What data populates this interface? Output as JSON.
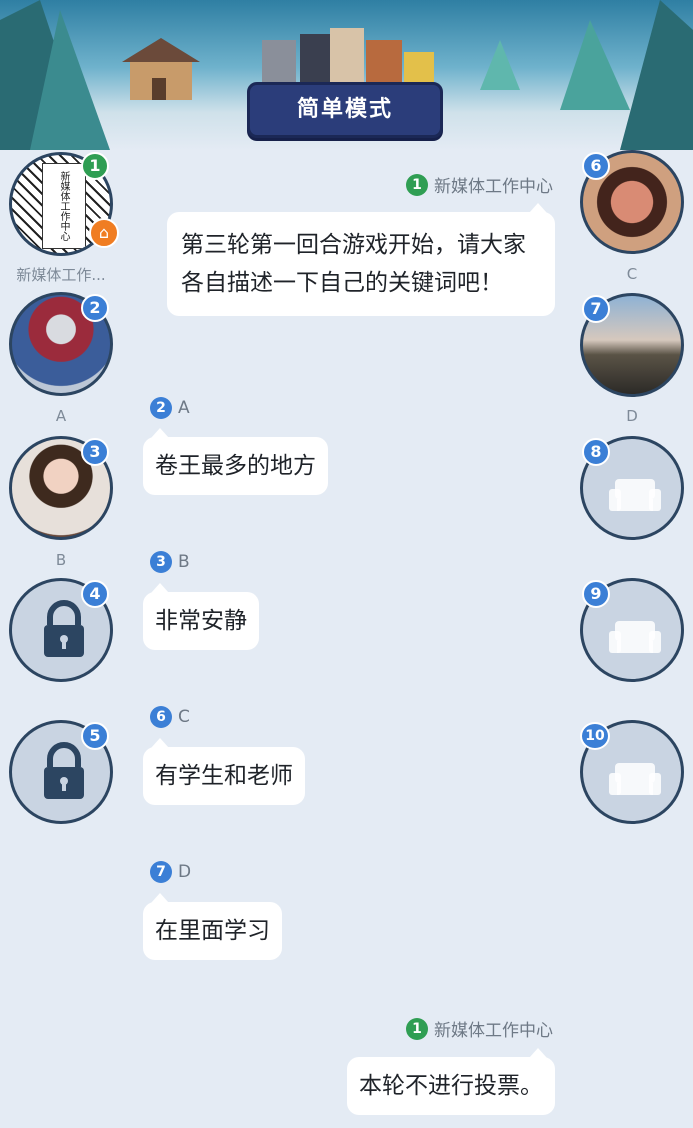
{
  "header": {
    "mode_label": "简单模式"
  },
  "seats": {
    "s1": {
      "number": "1",
      "name": "新媒体工作...",
      "avatar_text": "新媒体工作中心"
    },
    "s2": {
      "number": "2",
      "name": "A"
    },
    "s3": {
      "number": "3",
      "name": "B"
    },
    "s4": {
      "number": "4"
    },
    "s5": {
      "number": "5"
    },
    "s6": {
      "number": "6",
      "name": "C"
    },
    "s7": {
      "number": "7",
      "name": "D"
    },
    "s8": {
      "number": "8"
    },
    "s9": {
      "number": "9"
    },
    "s10": {
      "number": "10"
    }
  },
  "messages": [
    {
      "sender_number": "1",
      "sender": "新媒体工作中心",
      "text": "第三轮第一回合游戏开始，请大家各自描述一下自己的关键词吧！"
    },
    {
      "sender_number": "2",
      "sender": "A",
      "text": "卷王最多的地方"
    },
    {
      "sender_number": "3",
      "sender": "B",
      "text": "非常安静"
    },
    {
      "sender_number": "6",
      "sender": "C",
      "text": "有学生和老师"
    },
    {
      "sender_number": "7",
      "sender": "D",
      "text": "在里面学习"
    },
    {
      "sender_number": "1",
      "sender": "新媒体工作中心",
      "text": "本轮不进行投票。"
    }
  ],
  "colors": {
    "host_badge": "#2f9e53",
    "player_badge": "#3b7fd6",
    "home_badge": "#f07d22",
    "background": "#e4ebf4"
  },
  "icons": {
    "home": "home-icon",
    "lock": "lock-icon",
    "empty_seat": "sofa-icon"
  }
}
